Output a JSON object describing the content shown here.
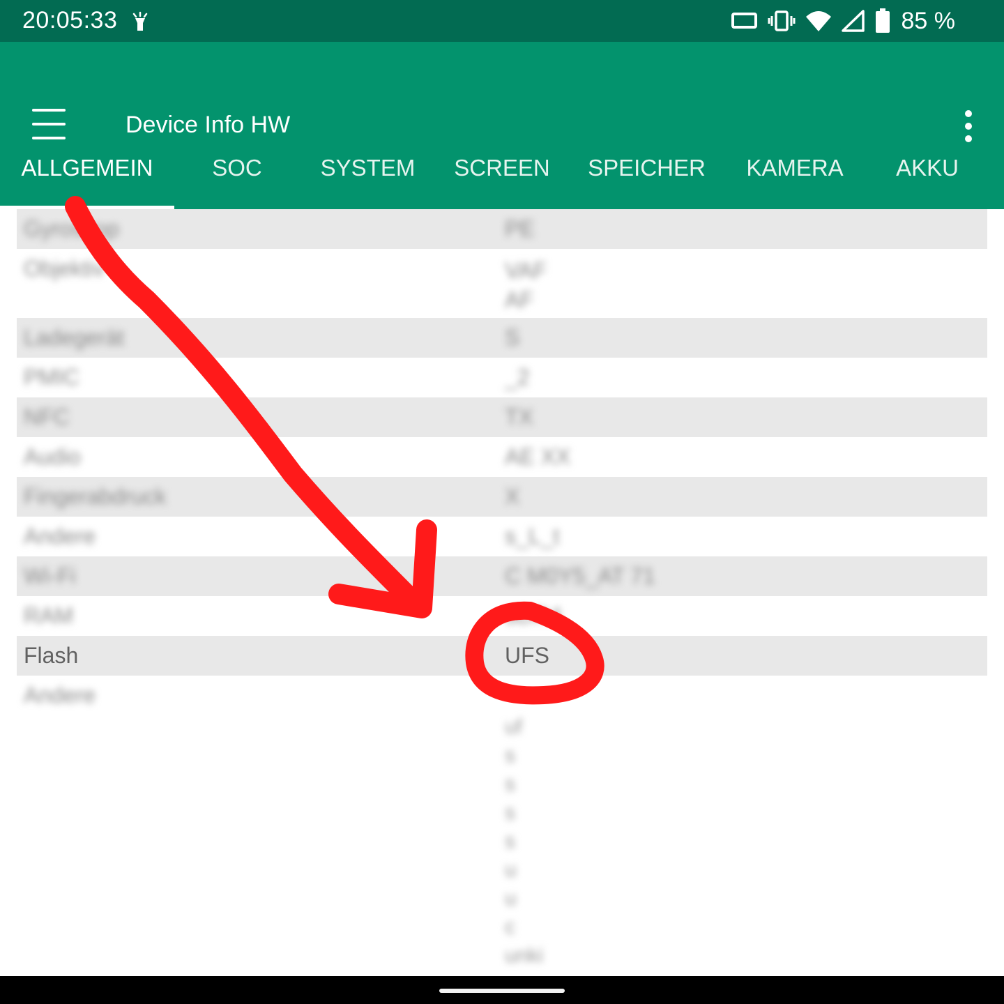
{
  "status_bar": {
    "time": "20:05:33",
    "battery_percent": "85 %",
    "icons": [
      "flashlight-icon",
      "screen-cast-icon",
      "vibrate-icon",
      "wifi-icon",
      "signal-icon",
      "battery-icon"
    ]
  },
  "app_bar": {
    "title": "Device Info HW",
    "menu_icon": "hamburger-menu-icon",
    "overflow_icon": "more-vert-icon"
  },
  "tabs": [
    {
      "label": "ALLGEMEIN",
      "active": true
    },
    {
      "label": "SOC",
      "active": false
    },
    {
      "label": "SYSTEM",
      "active": false
    },
    {
      "label": "SCREEN",
      "active": false
    },
    {
      "label": "SPEICHER",
      "active": false
    },
    {
      "label": "KAMERA",
      "active": false
    },
    {
      "label": "AKKU",
      "active": false
    }
  ],
  "rows": [
    {
      "label": "Gyroskop",
      "value": "PE"
    },
    {
      "label": "Objektiv",
      "value": "VAF\nAF"
    },
    {
      "label": "Ladegerät",
      "value": "S"
    },
    {
      "label": "PMIC",
      "value": "_2"
    },
    {
      "label": "NFC",
      "value": "TX"
    },
    {
      "label": "Audio",
      "value": "AE XX"
    },
    {
      "label": "Fingerabdruck",
      "value": "X"
    },
    {
      "label": "Andere",
      "value": "s_L_t"
    },
    {
      "label": "Wi-Fi",
      "value": "C M0Y5_AT 71"
    },
    {
      "label": "RAM",
      "value": "3DR4"
    },
    {
      "label": "Flash",
      "value": "UFS"
    },
    {
      "label": "Andere",
      "value": ""
    }
  ],
  "andere_values": [
    "uf",
    "s",
    "s",
    "s",
    "s",
    "u",
    "u",
    "c",
    "unki"
  ],
  "colors": {
    "status_bar": "#026b52",
    "app_bar": "#03936d",
    "row_shade": "#e8e8e8",
    "annotation": "#ff1a1a"
  }
}
